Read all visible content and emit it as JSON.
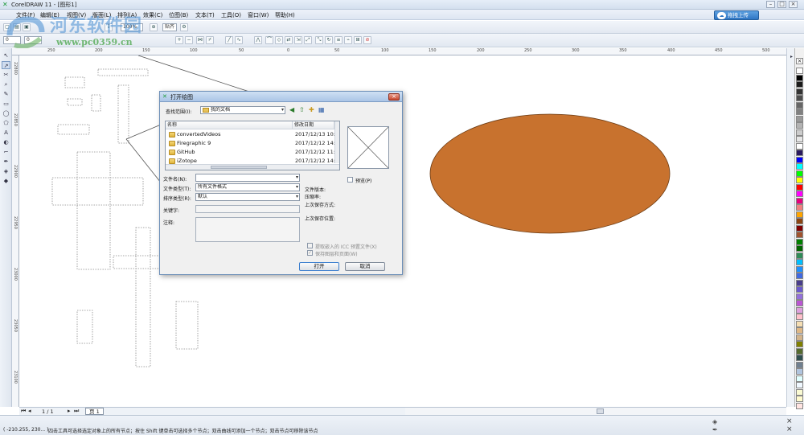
{
  "window": {
    "title": "CorelDRAW 11 - [图形1]",
    "controls": [
      "–",
      "□",
      "×"
    ]
  },
  "menu": {
    "items": [
      "文件(F)",
      "编辑(E)",
      "视图(V)",
      "版面(L)",
      "排列(A)",
      "效果(C)",
      "位图(B)",
      "文本(T)",
      "工具(O)",
      "窗口(W)",
      "帮助(H)"
    ],
    "cloud_upload": "拖拽上传"
  },
  "watermark": {
    "text": "河东软件园",
    "url": "www.pc0359.cn"
  },
  "toolbar": {
    "zoom_value": "100%",
    "snap_label": "贴齐",
    "x_field": "0",
    "y_field": "0"
  },
  "ruler": {
    "top_labels": [
      "250",
      "200",
      "150",
      "100",
      "50",
      "0",
      "50",
      "100",
      "150",
      "200",
      "250",
      "300",
      "350",
      "400",
      "450",
      "500"
    ],
    "left_labels": [
      "22800",
      "22850",
      "22900",
      "22950",
      "23000",
      "23050",
      "23100"
    ]
  },
  "dialog": {
    "title": "打开绘图",
    "look_in_label": "查找范围(I):",
    "look_in_value": "我的文档",
    "columns": {
      "name": "名称",
      "modified": "修改日期"
    },
    "files": [
      {
        "name": "convertedVideos",
        "date": "2017/12/13 10:"
      },
      {
        "name": "Firegraphic 9",
        "date": "2017/12/12 14:"
      },
      {
        "name": "GitHub",
        "date": "2017/12/12 11:"
      },
      {
        "name": "iZotope",
        "date": "2017/12/12 14:"
      }
    ],
    "file_name_label": "文件名(N):",
    "file_name_value": "",
    "file_type_label": "文件类型(T):",
    "file_type_value": "所有文件格式",
    "sort_label": "排序类型(R):",
    "sort_value": "默认",
    "keyword_label": "关键字:",
    "notes_label": "注释:",
    "thumbnail_label": "预览(P)",
    "file_version_label": "文件版本:",
    "compression_label": "压缩率:",
    "last_saved_as_label": "上次保存方式:",
    "last_saved_loc_label": "上次保存位置:",
    "extract_icc_label": "提取嵌入的 ICC 预置文件(X)",
    "keep_layers_label": "保持图层和页面(W)",
    "open_button": "打开",
    "cancel_button": "取消"
  },
  "pagenav": {
    "counter": "1 / 1",
    "page_tab": "页 1"
  },
  "status": {
    "coords": "( -210.255, 230... )",
    "hint": "四击工具可选择选定对象上的所有节点；按住 Shift 键单击可选择多个节点；双击曲线可添加一个节点；双击节点可移除该节点"
  },
  "colors": {
    "ellipse_fill": "#c8722e",
    "ellipse_stroke": "#6a3a12",
    "accent": "#2f76c4"
  },
  "palette": [
    "#ffffff",
    "#000000",
    "#1a1a1a",
    "#333333",
    "#4d4d4d",
    "#666666",
    "#808080",
    "#999999",
    "#b3b3b3",
    "#cccccc",
    "#e6e6e6",
    "#ffffff",
    "#2a1a5e",
    "#0000ff",
    "#00ffff",
    "#00ff00",
    "#ffff00",
    "#ff0000",
    "#ff00ff",
    "#e6007e",
    "#f08080",
    "#ffa500",
    "#8b4513",
    "#800000",
    "#a0522d",
    "#008000",
    "#006400",
    "#2e8b57",
    "#00bfff",
    "#1e90ff",
    "#4169e1",
    "#483d8b",
    "#6a5acd",
    "#9370db",
    "#ba55d3",
    "#dda0dd",
    "#ffc0cb",
    "#f5deb3",
    "#deb887",
    "#d2b48c",
    "#808000",
    "#556b2f",
    "#2f4f4f",
    "#708090",
    "#b0c4de",
    "#e0ffff",
    "#f0f8ff",
    "#fafad2",
    "#fffacd",
    "#ffe4e1"
  ]
}
